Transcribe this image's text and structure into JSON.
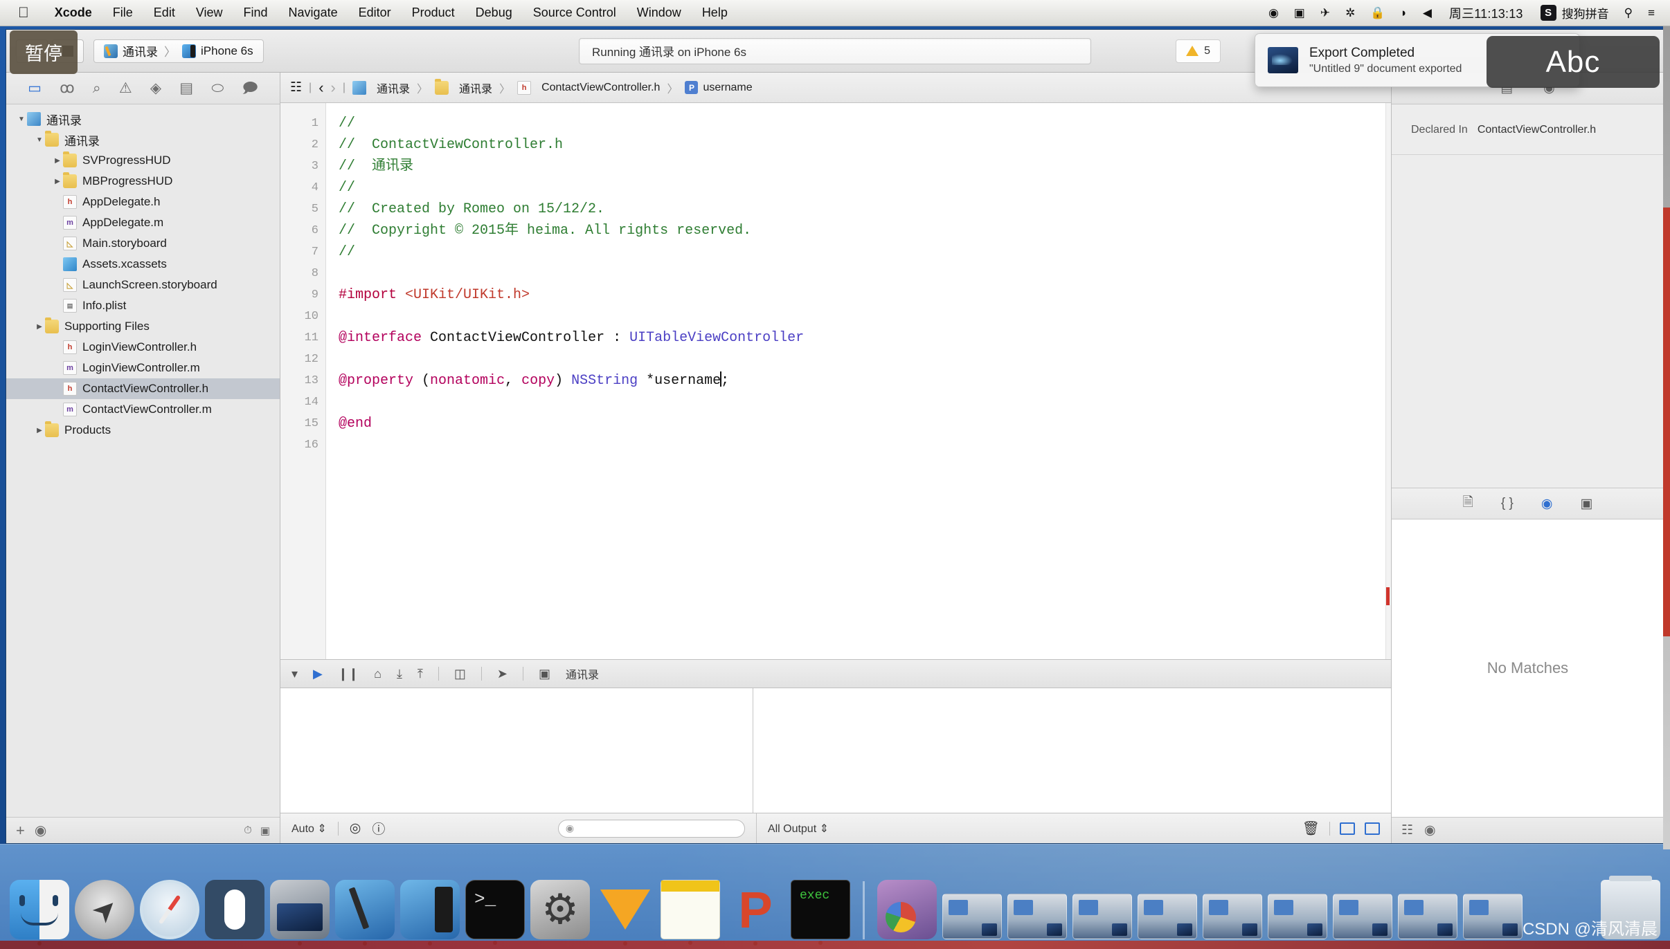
{
  "menubar": {
    "apple_icon": "apple-icon",
    "items": [
      {
        "label": "Xcode",
        "bold": true
      },
      {
        "label": "File"
      },
      {
        "label": "Edit"
      },
      {
        "label": "View"
      },
      {
        "label": "Find"
      },
      {
        "label": "Navigate"
      },
      {
        "label": "Editor"
      },
      {
        "label": "Product"
      },
      {
        "label": "Debug"
      },
      {
        "label": "Source Control"
      },
      {
        "label": "Window"
      },
      {
        "label": "Help"
      }
    ],
    "status_items": [
      {
        "name": "dropbox-icon",
        "glyph": "◉"
      },
      {
        "name": "screen-recording-icon",
        "glyph": "▣"
      },
      {
        "name": "airplay-icon",
        "glyph": "✈"
      },
      {
        "name": "bluetooth-icon",
        "glyph": "✲"
      },
      {
        "name": "lock-icon",
        "glyph": "🔒"
      },
      {
        "name": "wifi-icon",
        "glyph": "◗"
      },
      {
        "name": "volume-icon",
        "glyph": "◀"
      }
    ],
    "clock": "周三11:13:13",
    "ime_badge": "S",
    "ime_label": "搜狗拼音",
    "search_icon": "search-icon",
    "notification_center_icon": "notification-center-icon"
  },
  "toolbar": {
    "run_label": "Run",
    "stop_label": "Stop",
    "scheme_project": "通讯录",
    "scheme_separator": "〉",
    "scheme_device": "iPhone 6s",
    "status_text": "Running 通讯录 on iPhone 6s",
    "warning_count": "5"
  },
  "overlays": {
    "pause_tooltip": "暂停",
    "notification": {
      "title": "Export Completed",
      "subtitle": "\"Untitled 9\" document exported"
    },
    "input_hud": "Abc"
  },
  "navigator": {
    "tabs": [
      {
        "name": "project-navigator-tab",
        "glyph": "▭",
        "active": true
      },
      {
        "name": "source-control-navigator-tab",
        "glyph": "ꚙ",
        "active": false
      },
      {
        "name": "symbol-navigator-tab",
        "glyph": "⌕",
        "active": false
      },
      {
        "name": "issue-navigator-tab",
        "glyph": "⚠",
        "active": false
      },
      {
        "name": "test-navigator-tab",
        "glyph": "◈",
        "active": false
      },
      {
        "name": "debug-navigator-tab",
        "glyph": "▤",
        "active": false
      },
      {
        "name": "breakpoint-navigator-tab",
        "glyph": "⬭",
        "active": false
      },
      {
        "name": "report-navigator-tab",
        "glyph": "🗩",
        "active": false
      }
    ],
    "tree": [
      {
        "label": "通讯录",
        "indent": 0,
        "icon": "proj",
        "disclosure": "open",
        "selected": false
      },
      {
        "label": "通讯录",
        "indent": 1,
        "icon": "folder",
        "disclosure": "open",
        "selected": false
      },
      {
        "label": "SVProgressHUD",
        "indent": 2,
        "icon": "folder",
        "disclosure": "closed",
        "selected": false
      },
      {
        "label": "MBProgressHUD",
        "indent": 2,
        "icon": "folder",
        "disclosure": "closed",
        "selected": false
      },
      {
        "label": "AppDelegate.h",
        "indent": 2,
        "icon": "h",
        "disclosure": "none",
        "selected": false
      },
      {
        "label": "AppDelegate.m",
        "indent": 2,
        "icon": "m",
        "disclosure": "none",
        "selected": false
      },
      {
        "label": "Main.storyboard",
        "indent": 2,
        "icon": "sb",
        "disclosure": "none",
        "selected": false
      },
      {
        "label": "Assets.xcassets",
        "indent": 2,
        "icon": "assets",
        "disclosure": "none",
        "selected": false
      },
      {
        "label": "LaunchScreen.storyboard",
        "indent": 2,
        "icon": "sb",
        "disclosure": "none",
        "selected": false
      },
      {
        "label": "Info.plist",
        "indent": 2,
        "icon": "plist",
        "disclosure": "none",
        "selected": false
      },
      {
        "label": "Supporting Files",
        "indent": 1,
        "icon": "folder",
        "disclosure": "closed",
        "selected": false
      },
      {
        "label": "LoginViewController.h",
        "indent": 2,
        "icon": "h",
        "disclosure": "none",
        "selected": false
      },
      {
        "label": "LoginViewController.m",
        "indent": 2,
        "icon": "m",
        "disclosure": "none",
        "selected": false
      },
      {
        "label": "ContactViewController.h",
        "indent": 2,
        "icon": "h",
        "disclosure": "none",
        "selected": true
      },
      {
        "label": "ContactViewController.m",
        "indent": 2,
        "icon": "m",
        "disclosure": "none",
        "selected": false
      },
      {
        "label": "Products",
        "indent": 1,
        "icon": "folder",
        "disclosure": "closed",
        "selected": false
      }
    ],
    "footer": {
      "add_label": "+",
      "filter_icon": "filter-icon",
      "recent_icon": "recent-icon",
      "source-control-icon": "source-control-icon"
    }
  },
  "jumpbar": {
    "related_items_icon": "related-items-icon",
    "back_icon": "‹",
    "forward_icon": "›",
    "crumbs": [
      {
        "label": "通讯录",
        "icon": "project-icon"
      },
      {
        "label": "通讯录",
        "icon": "folder-icon"
      },
      {
        "label": "ContactViewController.h",
        "icon": "header-file-icon"
      },
      {
        "label": "username",
        "icon": "property-badge"
      }
    ]
  },
  "editor": {
    "lines": [
      {
        "n": "1",
        "tokens": [
          {
            "t": "//",
            "c": "comment"
          }
        ]
      },
      {
        "n": "2",
        "tokens": [
          {
            "t": "//  ContactViewController.h",
            "c": "comment"
          }
        ]
      },
      {
        "n": "3",
        "tokens": [
          {
            "t": "//  通讯录",
            "c": "comment"
          }
        ]
      },
      {
        "n": "4",
        "tokens": [
          {
            "t": "//",
            "c": "comment"
          }
        ]
      },
      {
        "n": "5",
        "tokens": [
          {
            "t": "//  Created by Romeo on 15/12/2.",
            "c": "comment"
          }
        ]
      },
      {
        "n": "6",
        "tokens": [
          {
            "t": "//  Copyright © 2015年 heima. All rights reserved.",
            "c": "comment"
          }
        ]
      },
      {
        "n": "7",
        "tokens": [
          {
            "t": "//",
            "c": "comment"
          }
        ]
      },
      {
        "n": "8",
        "tokens": []
      },
      {
        "n": "9",
        "tokens": [
          {
            "t": "#import ",
            "c": "pre"
          },
          {
            "t": "<UIKit/UIKit.h>",
            "c": "str"
          }
        ]
      },
      {
        "n": "10",
        "tokens": []
      },
      {
        "n": "11",
        "tokens": [
          {
            "t": "@interface ",
            "c": "kw"
          },
          {
            "t": "ContactViewController",
            "c": "plain"
          },
          {
            "t": " : ",
            "c": "plain"
          },
          {
            "t": "UITableViewController",
            "c": "type"
          }
        ]
      },
      {
        "n": "12",
        "tokens": []
      },
      {
        "n": "13",
        "tokens": [
          {
            "t": "@property ",
            "c": "kw"
          },
          {
            "t": "(",
            "c": "plain"
          },
          {
            "t": "nonatomic",
            "c": "kw"
          },
          {
            "t": ", ",
            "c": "plain"
          },
          {
            "t": "copy",
            "c": "kw"
          },
          {
            "t": ") ",
            "c": "plain"
          },
          {
            "t": "NSString",
            "c": "type"
          },
          {
            "t": " *username",
            "c": "plain"
          },
          {
            "t": "CARET",
            "c": "caret"
          },
          {
            "t": ";",
            "c": "plain"
          }
        ]
      },
      {
        "n": "14",
        "tokens": []
      },
      {
        "n": "15",
        "tokens": [
          {
            "t": "@end",
            "c": "kw"
          }
        ]
      },
      {
        "n": "16",
        "tokens": []
      }
    ]
  },
  "debugbar": {
    "icons": [
      {
        "name": "hide-debug-area-icon",
        "glyph": "▾"
      },
      {
        "name": "continue-icon",
        "glyph": "▶",
        "accent": true
      },
      {
        "name": "pause-icon",
        "glyph": "❙❙"
      },
      {
        "name": "step-over-icon",
        "glyph": "⌂"
      },
      {
        "name": "step-into-icon",
        "glyph": "⤓"
      },
      {
        "name": "step-out-icon",
        "glyph": "⤒"
      },
      {
        "name": "view-hierarchy-icon",
        "glyph": "◫"
      },
      {
        "name": "simulate-location-icon",
        "glyph": "➤"
      },
      {
        "name": "stack-frame-icon",
        "glyph": "▣"
      }
    ],
    "process_label": "通讯录"
  },
  "debug_status": {
    "scope_label": "Auto",
    "scope_chevron": "⇕",
    "watch_icon": "watch-icon",
    "info_icon": "info-icon",
    "variables_filter_placeholder": "",
    "output_label": "All Output",
    "output_chevron": "⇕",
    "trash_icon": "trash-icon",
    "pane_toggle_left": "console-pane-toggle",
    "pane_toggle_right": "variables-pane-toggle"
  },
  "utilities": {
    "tabs": [
      {
        "name": "file-inspector-tab",
        "glyph": "▤"
      },
      {
        "name": "quick-help-inspector-tab",
        "glyph": "◉"
      }
    ],
    "quick_help": {
      "declared_in_label": "Declared In",
      "declared_in_value": "ContactViewController.h"
    },
    "library_tabs": [
      {
        "name": "file-template-library-tab",
        "glyph": "🗎",
        "active": false
      },
      {
        "name": "code-snippet-library-tab",
        "glyph": "{ }",
        "active": false
      },
      {
        "name": "object-library-tab",
        "glyph": "◉",
        "active": true
      },
      {
        "name": "media-library-tab",
        "glyph": "▣",
        "active": false
      }
    ],
    "library_empty_text": "No Matches",
    "filter_placeholder": "",
    "filter_icons": [
      "grid-icon",
      "filter-icon"
    ]
  },
  "dock": {
    "items": [
      {
        "name": "dock-item-finder",
        "cls": "dk-finder",
        "running": true
      },
      {
        "name": "dock-item-launchpad",
        "cls": "dk-launch",
        "running": false
      },
      {
        "name": "dock-item-safari",
        "cls": "dk-safari",
        "running": false
      },
      {
        "name": "dock-item-mouse-utility",
        "cls": "dk-mouse",
        "running": false
      },
      {
        "name": "dock-item-quicktime",
        "cls": "dk-quicktime",
        "running": true
      },
      {
        "name": "dock-item-xcode",
        "cls": "dk-xcode",
        "running": true
      },
      {
        "name": "dock-item-xcode-simulator",
        "cls": "dk-xcode-sim",
        "running": true
      },
      {
        "name": "dock-item-terminal",
        "cls": "dk-terminal",
        "running": true
      },
      {
        "name": "dock-item-system-preferences",
        "cls": "dk-sysprefs",
        "running": false
      },
      {
        "name": "dock-item-sketch",
        "cls": "dk-sketch",
        "running": true
      },
      {
        "name": "dock-item-notes",
        "cls": "dk-notes",
        "running": true
      },
      {
        "name": "dock-item-paintcode",
        "cls": "dk-paintcode",
        "running": true
      },
      {
        "name": "dock-item-exec",
        "cls": "dk-exec",
        "running": true
      }
    ],
    "minimized_windows": 9,
    "chrome_item": {
      "name": "dock-item-chrome",
      "cls": "dk-chrome"
    },
    "trash_item": {
      "name": "dock-item-trash",
      "cls": "dk-trash"
    }
  },
  "watermark": "CSDN @清风清晨"
}
